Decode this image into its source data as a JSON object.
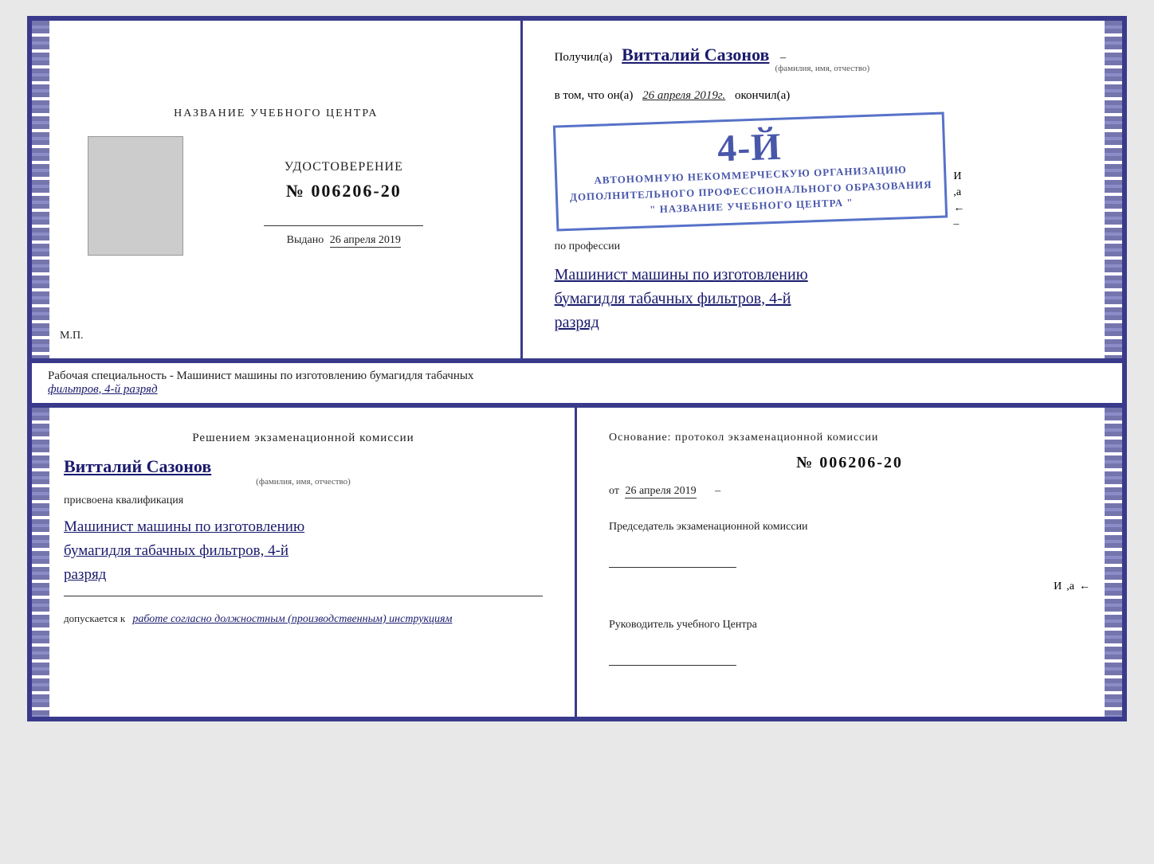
{
  "cert_top": {
    "left": {
      "title": "НАЗВАНИЕ УЧЕБНОГО ЦЕНТРА",
      "udostoverenie_label": "УДОСТОВЕРЕНИЕ",
      "number": "№ 006206-20",
      "vydano_label": "Выдано",
      "vydano_date": "26 апреля 2019",
      "mp": "М.П."
    },
    "right": {
      "poluchil_label": "Получил(а)",
      "name": "Витталий Сазонов",
      "name_sub": "(фамилия, имя, отчество)",
      "vtom_label": "в том, что он(а)",
      "date": "26 апреля 2019г.",
      "okonchil_label": "окончил(а)",
      "stamp_4": "4-й",
      "stamp_line1": "АВТОНОМНУЮ НЕКОММЕРЧЕСКУЮ ОРГАНИЗАЦИЮ",
      "stamp_line2": "ДОПОЛНИТЕЛЬНОГО ПРОФЕССИОНАЛЬНОГО ОБРАЗОВАНИЯ",
      "stamp_line3": "\" НАЗВАНИЕ УЧЕБНОГО ЦЕНТРА \"",
      "professiya_label": "по профессии",
      "prof_value_1": "Машинист машины по изготовлению",
      "prof_value_2": "бумагидля табачных фильтров, 4-й",
      "prof_value_3": "разряд"
    }
  },
  "middle": {
    "text1": "Рабочая специальность - Машинист машины по изготовлению бумагидля табачных",
    "text2": "фильтров, 4-й разряд"
  },
  "cert_bottom": {
    "left": {
      "title": "Решением экзаменационной комиссии",
      "name": "Витталий Сазонов",
      "name_sub": "(фамилия, имя, отчество)",
      "prisvoena_label": "присвоена квалификация",
      "qual_1": "Машинист машины по изготовлению",
      "qual_2": "бумагидля табачных фильтров, 4-й",
      "qual_3": "разряд",
      "dopuskaetsya_label": "допускается к",
      "dopusk_value": "работе согласно должностным (производственным) инструкциям"
    },
    "right": {
      "osnov_label": "Основание: протокол экзаменационной комиссии",
      "number": "№ 006206-20",
      "ot_label": "от",
      "date": "26 апреля 2019",
      "predsedatel_label": "Председатель экзаменационной комиссии",
      "rukovod_label": "Руководитель учебного Центра"
    }
  }
}
